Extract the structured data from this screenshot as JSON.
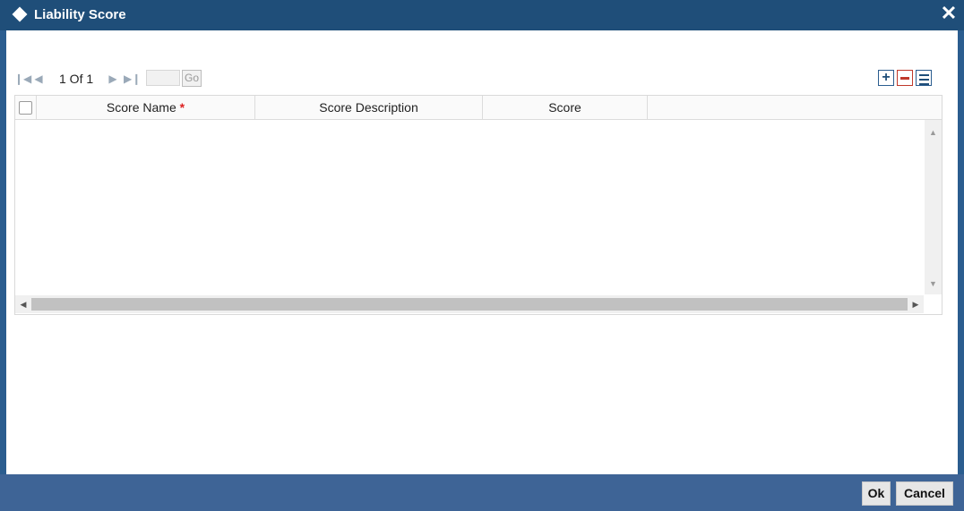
{
  "window": {
    "title": "Liability Score",
    "close_symbol": "✕"
  },
  "toolbar": {
    "page_info": "1 Of 1",
    "go_label": "Go",
    "page_input_value": ""
  },
  "grid": {
    "columns": [
      {
        "label": "Score Name",
        "required": "*"
      },
      {
        "label": "Score Description"
      },
      {
        "label": "Score"
      }
    ],
    "rows": []
  },
  "footer": {
    "ok_label": "Ok",
    "cancel_label": "Cancel"
  },
  "colors": {
    "title_bar": "#1f4e79",
    "footer_bar": "#3e6496",
    "required_marker": "#dd2222"
  },
  "icons": [
    "diamond-icon",
    "close-icon",
    "first-page-icon",
    "prev-page-icon",
    "next-page-icon",
    "last-page-icon",
    "add-row-icon",
    "delete-row-icon",
    "single-view-icon"
  ]
}
